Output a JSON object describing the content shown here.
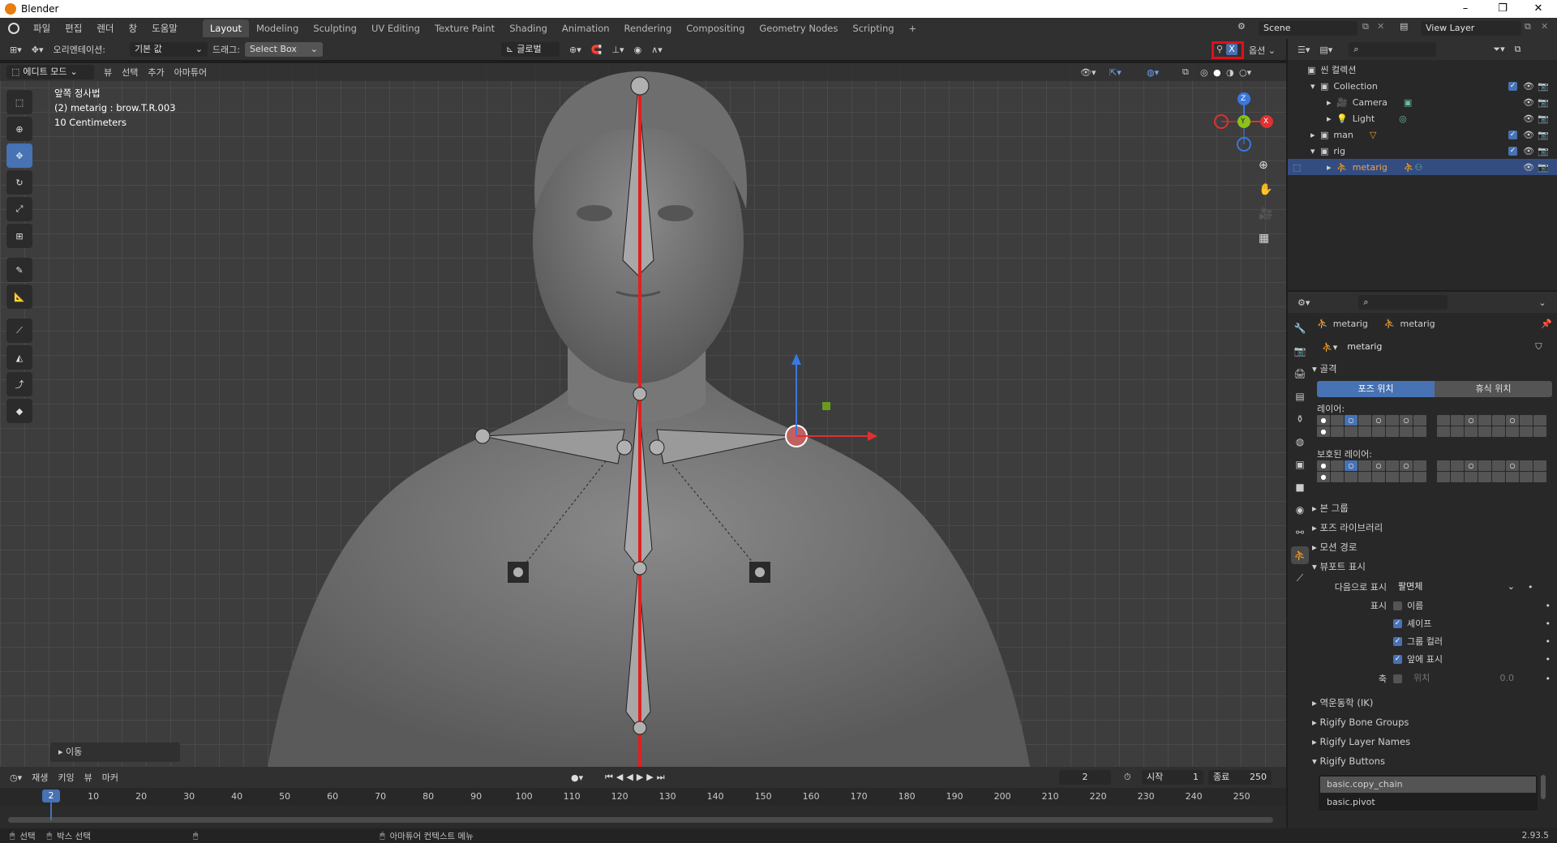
{
  "window": {
    "title": "Blender",
    "min": "–",
    "max": "❐",
    "close": "✕"
  },
  "menu": {
    "items": [
      "파일",
      "편집",
      "렌더",
      "창",
      "도움말"
    ]
  },
  "workspaces": [
    "Layout",
    "Modeling",
    "Sculpting",
    "UV Editing",
    "Texture Paint",
    "Shading",
    "Animation",
    "Rendering",
    "Compositing",
    "Geometry Nodes",
    "Scripting"
  ],
  "workspace_add": "+",
  "scene": {
    "name": "Scene",
    "view_layer": "View Layer"
  },
  "viewport_header": {
    "orientation_label": "오리엔테이션:",
    "orientation_value": "기본 값",
    "drag_label": "드래그:",
    "drag_value": "Select Box",
    "transform_space": "글로벌",
    "options": "옵션",
    "xray_badge": "X"
  },
  "viewport_menu": {
    "mode": "에디트 모드",
    "items": [
      "뷰",
      "선택",
      "추가",
      "아마튜어"
    ]
  },
  "viewport_overlay": {
    "line1": "앞쪽 정사법",
    "line2": "(2) metarig : brow.T.R.003",
    "line3": "10 Centimeters"
  },
  "last_op": {
    "label": "이동"
  },
  "gizmo": {
    "x": "X",
    "y": "Y",
    "z": "Z"
  },
  "outliner": {
    "rows": [
      {
        "label": "씬 컬렉션",
        "indent": 0
      },
      {
        "label": "Collection",
        "indent": 1
      },
      {
        "label": "Camera",
        "indent": 2
      },
      {
        "label": "Light",
        "indent": 2
      },
      {
        "label": "man",
        "indent": 1
      },
      {
        "label": "rig",
        "indent": 1
      },
      {
        "label": "metarig",
        "indent": 2,
        "selected": true
      }
    ]
  },
  "properties": {
    "breadcrumb_left": "metarig",
    "breadcrumb_right": "metarig",
    "data_name": "metarig",
    "skeleton_header": "골격",
    "pose_position": "포즈 위치",
    "rest_position": "휴식 위치",
    "layers_label": "레이어:",
    "protected_layers_label": "보호된 레이어:",
    "collapsed": [
      "본 그룹",
      "포즈 라이브러리",
      "모션 경로"
    ],
    "viewport_display": "뷰포트 표시",
    "display_as_label": "다음으로 표시",
    "display_as_value": "팔면체",
    "show_label": "표시",
    "show_items": [
      {
        "label": "이름",
        "checked": false
      },
      {
        "label": "셰이프",
        "checked": true
      },
      {
        "label": "그룹 컬러",
        "checked": true
      },
      {
        "label": "앞에 표시",
        "checked": true
      }
    ],
    "axes_label": "축",
    "axes_pos_label": "위치",
    "axes_pos_value": "0.0",
    "more": [
      "역운동학 (IK)",
      "Rigify Bone Groups",
      "Rigify Layer Names"
    ],
    "rigify_buttons": "Rigify Buttons",
    "rigify_list": [
      "basic.copy_chain",
      "basic.pivot"
    ]
  },
  "timeline": {
    "menu": [
      "재생",
      "키잉",
      "뷰",
      "마커"
    ],
    "current_frame": "2",
    "start_label": "시작",
    "start": "1",
    "end_label": "종료",
    "end": "250",
    "ticks": [
      "10",
      "20",
      "30",
      "40",
      "50",
      "60",
      "70",
      "80",
      "90",
      "100",
      "110",
      "120",
      "130",
      "140",
      "150",
      "160",
      "170",
      "180",
      "190",
      "200",
      "210",
      "220",
      "230",
      "240",
      "250"
    ],
    "playhead": "2"
  },
  "status": {
    "select": "선택",
    "box_select": "박스 선택",
    "context_menu": "아마튜어 컨텍스트 메뉴",
    "version": "2.93.5"
  },
  "colors": {
    "accent": "#4772b3",
    "highlight_box": "#e0101a",
    "bone_red": "#e02020",
    "selected_row": "#334d80"
  }
}
